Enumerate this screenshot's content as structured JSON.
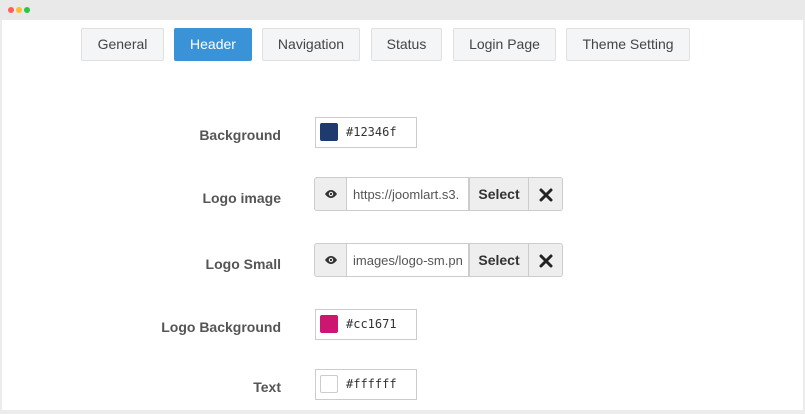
{
  "tabs": [
    {
      "label": "General",
      "active": false
    },
    {
      "label": "Header",
      "active": true
    },
    {
      "label": "Navigation",
      "active": false
    },
    {
      "label": "Status",
      "active": false
    },
    {
      "label": "Login Page",
      "active": false
    },
    {
      "label": "Theme Setting",
      "active": false
    }
  ],
  "fields": {
    "background": {
      "label": "Background",
      "value": "#12346f",
      "swatch": "#1e3a6f"
    },
    "logo_image": {
      "label": "Logo image",
      "value": "https://joomlart.s3.",
      "select_label": "Select"
    },
    "logo_small": {
      "label": "Logo Small",
      "value": "images/logo-sm.pn",
      "select_label": "Select"
    },
    "logo_background": {
      "label": "Logo Background",
      "value": "#cc1671",
      "swatch": "#cc1671"
    },
    "text": {
      "label": "Text",
      "value": "#ffffff",
      "swatch": "#ffffff"
    }
  },
  "icons": {
    "preview": "eye-icon",
    "clear": "close-icon"
  }
}
